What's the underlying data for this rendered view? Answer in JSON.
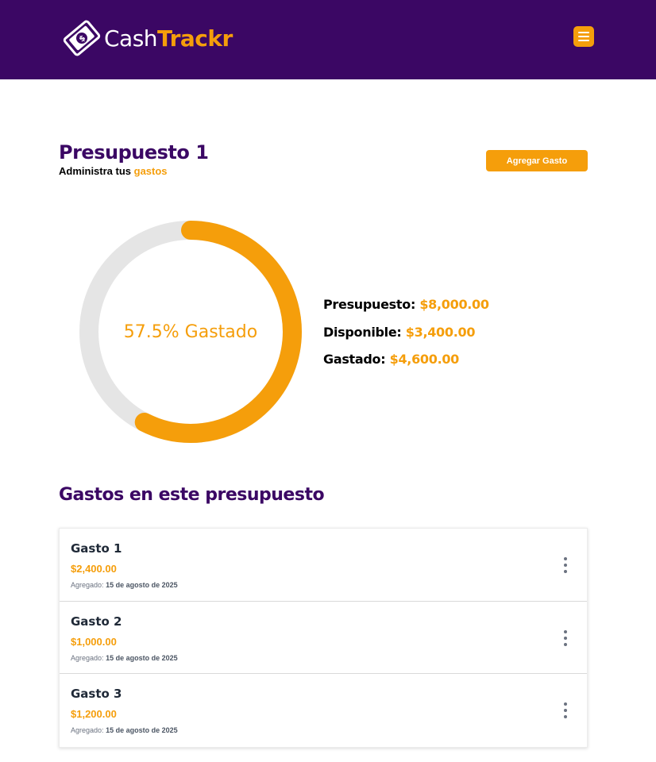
{
  "brand": {
    "cash": "Cash",
    "trackr": "Trackr"
  },
  "header": {
    "menu_icon": "hamburger-menu-icon"
  },
  "budget": {
    "title": "Presupuesto 1",
    "subtitle_prefix": "Administra tus ",
    "subtitle_accent": "gastos",
    "add_button": "Agregar Gasto"
  },
  "progress": {
    "percent": 57.5,
    "label": "57.5% Gastado",
    "color_filled": "#f59e0b",
    "color_track": "#e5e5e5"
  },
  "stats": [
    {
      "label": "Presupuesto:",
      "value": "$8,000.00"
    },
    {
      "label": "Disponible:",
      "value": "$3,400.00"
    },
    {
      "label": "Gastado:",
      "value": "$4,600.00"
    }
  ],
  "expenses": {
    "title": "Gastos en este presupuesto",
    "items": [
      {
        "name": "Gasto 1",
        "amount": "$2,400.00",
        "date_label": "Agregado:",
        "date": "15 de agosto de 2025"
      },
      {
        "name": "Gasto 2",
        "amount": "$1,000.00",
        "date_label": "Agregado:",
        "date": "15 de agosto de 2025"
      },
      {
        "name": "Gasto 3",
        "amount": "$1,200.00",
        "date_label": "Agregado:",
        "date": "15 de agosto de 2025"
      }
    ]
  },
  "colors": {
    "primary": "#3b0764",
    "accent": "#f59e0b"
  }
}
